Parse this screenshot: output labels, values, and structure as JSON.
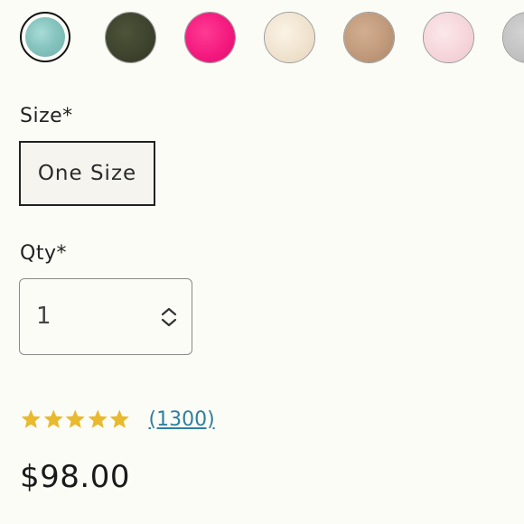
{
  "swatches": [
    {
      "name": "teal",
      "selected": true
    },
    {
      "name": "olive",
      "selected": false
    },
    {
      "name": "pink",
      "selected": false
    },
    {
      "name": "cream",
      "selected": false
    },
    {
      "name": "tan",
      "selected": false
    },
    {
      "name": "blush",
      "selected": false
    },
    {
      "name": "grey",
      "selected": false
    }
  ],
  "size": {
    "label": "Size*",
    "options": [
      "One Size"
    ],
    "selected": "One Size"
  },
  "qty": {
    "label": "Qty*",
    "value": "1"
  },
  "rating": {
    "stars": 5,
    "review_count": "(1300)",
    "star_color": "#e9b92e"
  },
  "price": "$98.00",
  "colors": {
    "link": "#2f7fa0",
    "background": "#fcfcf7"
  }
}
